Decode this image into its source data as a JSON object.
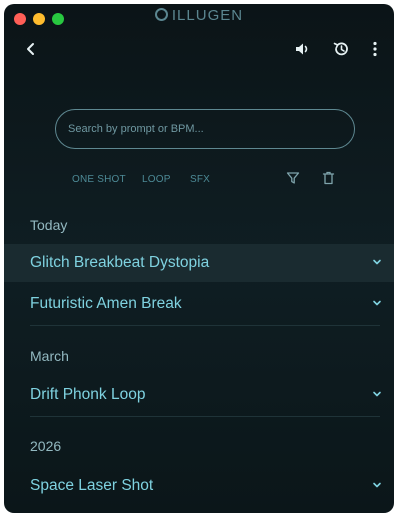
{
  "app": {
    "title": "ILLUGEN"
  },
  "toolbar": {
    "back_icon": "chevron-left-icon",
    "volume_icon": "speaker-icon",
    "history_icon": "history-icon",
    "more_icon": "more-vertical-icon"
  },
  "search": {
    "placeholder": "Search by prompt or BPM..."
  },
  "filters": {
    "tabs": [
      "ONE SHOT",
      "LOOP",
      "SFX"
    ],
    "filter_icon": "filter-icon",
    "trash_icon": "trash-icon"
  },
  "sections": [
    {
      "header": "Today",
      "items": [
        {
          "label": "Glitch Breakbeat Dystopia",
          "active": true
        },
        {
          "label": "Futuristic Amen Break",
          "active": false
        }
      ]
    },
    {
      "header": "March",
      "items": [
        {
          "label": "Drift Phonk Loop",
          "active": false
        }
      ]
    },
    {
      "header": "2026",
      "items": [
        {
          "label": "Space Laser Shot",
          "active": false
        }
      ]
    }
  ],
  "colors": {
    "background": "#0f1e23",
    "accent_text": "#7fd2e0",
    "section_text": "#93b9c1",
    "active_row": "#1a2b30",
    "tab_text": "#4d8a96"
  }
}
